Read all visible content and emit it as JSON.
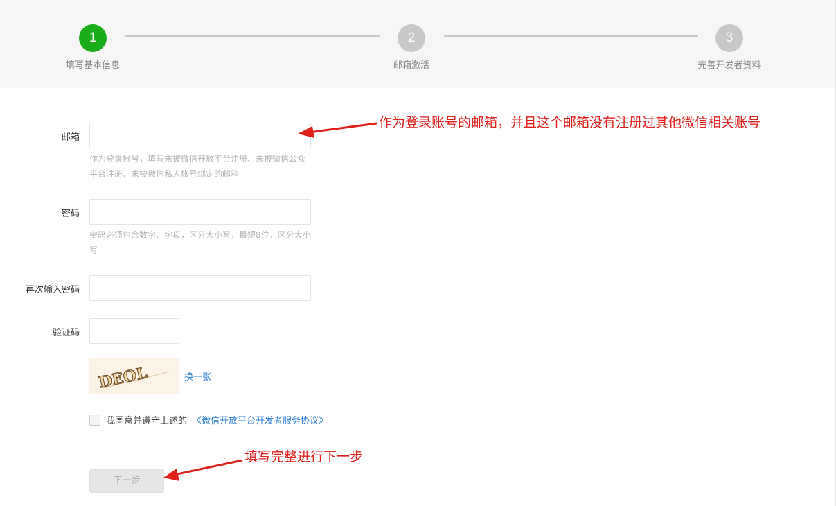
{
  "steps": [
    {
      "number": "1",
      "label": "填写基本信息",
      "state": "active"
    },
    {
      "number": "2",
      "label": "邮箱激活",
      "state": "pending"
    },
    {
      "number": "3",
      "label": "完善开发者资料",
      "state": "pending"
    }
  ],
  "form": {
    "email": {
      "label": "邮箱",
      "value": "",
      "hint": "作为登录帐号，填写未被微信开放平台注册、未被微信公众平台注册、未被微信私人帐号绑定的邮箱"
    },
    "password": {
      "label": "密码",
      "value": "",
      "hint": "密码必须包含数字、字母，区分大小写，最短8位，区分大小写"
    },
    "confirm_password": {
      "label": "再次输入密码",
      "value": ""
    },
    "captcha": {
      "label": "验证码",
      "value": "",
      "image_text": "DEOL",
      "refresh_label": "换一张"
    },
    "agreement": {
      "prefix": "我同意并遵守上述的",
      "link": "《微信开放平台开发者服务协议》",
      "checked": false
    }
  },
  "next_button": "下一步",
  "annotations": {
    "email_note": "作为登录账号的邮箱，并且这个邮箱没有注册过其他微信相关账号",
    "next_note": "填写完整进行下一步"
  },
  "colors": {
    "step_active": "#1aad19",
    "step_pending": "#c8c8c8",
    "link": "#2e7ed9",
    "annotation": "#e0201a"
  }
}
